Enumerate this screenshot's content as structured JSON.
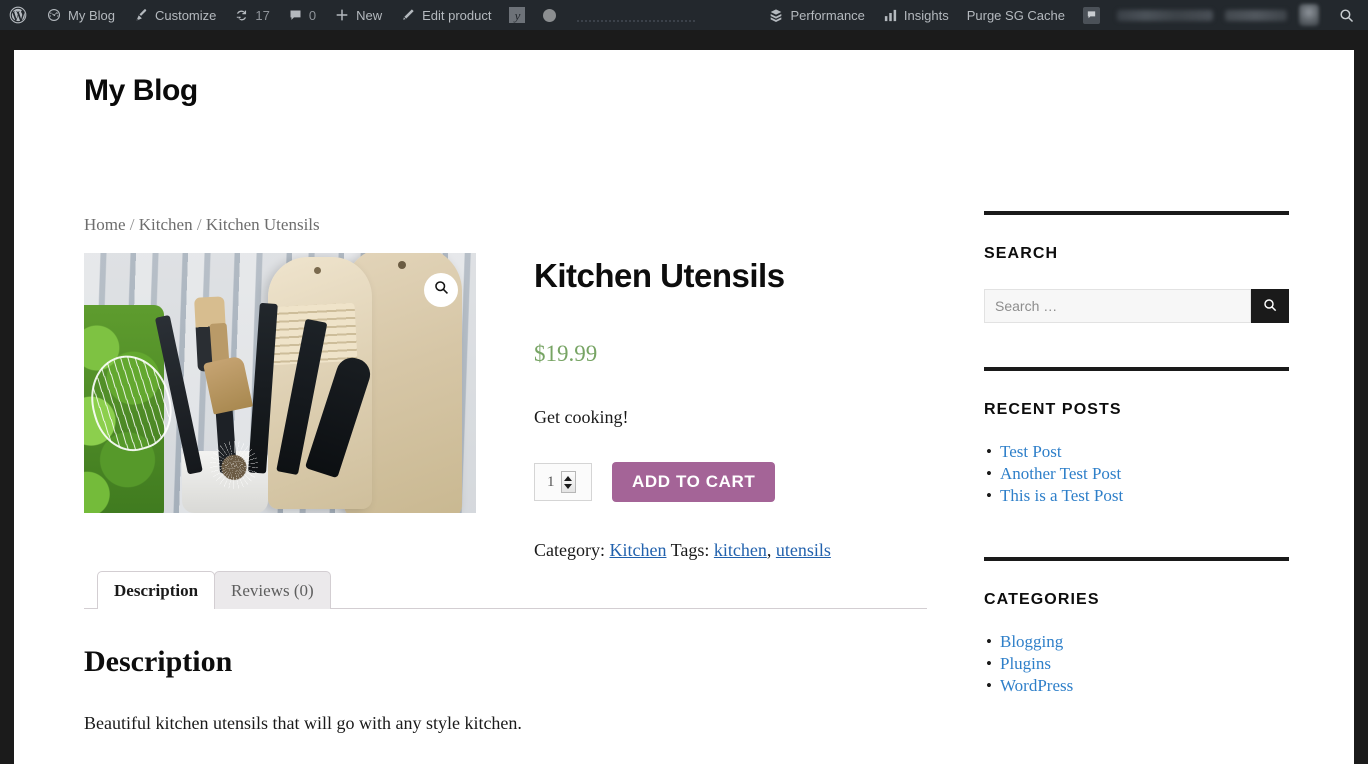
{
  "admin_bar": {
    "wp_logo_icon": "wordpress-logo-icon",
    "items": [
      {
        "label": "My Blog",
        "icon": "dashboard-gauge-icon"
      },
      {
        "label": "Customize",
        "icon": "paintbrush-icon"
      },
      {
        "label": "17",
        "icon": "updates-arrows-icon"
      },
      {
        "label": "0",
        "icon": "comment-bubble-icon"
      },
      {
        "label": "New",
        "icon": "plus-icon"
      },
      {
        "label": "Edit product",
        "icon": "pencil-icon"
      },
      {
        "label": "",
        "icon": "yoast-seo-icon"
      },
      {
        "label": "",
        "icon": "grey-dot-icon"
      }
    ],
    "right_items": [
      {
        "label": "Performance",
        "icon": "performance-icon"
      },
      {
        "label": "Insights",
        "icon": "bar-chart-icon"
      },
      {
        "label": "Purge SG Cache",
        "icon": ""
      }
    ],
    "notification_icon": "flag-icon",
    "search_icon": "search-icon",
    "user_name_redacted": "",
    "colors": {
      "bar_bg": "#23282d",
      "bar_text": "#b4b9be"
    }
  },
  "site": {
    "title": "My Blog",
    "page_frame_bg": "#1b1b1b"
  },
  "breadcrumb": {
    "items": [
      "Home",
      "Kitchen",
      "Kitchen Utensils"
    ],
    "separator": "/"
  },
  "product": {
    "title": "Kitchen Utensils",
    "price": "$19.99",
    "price_color": "#77a464",
    "short_description": "Get cooking!",
    "image_alt": "kitchen utensils in a white crock with wooden cutting boards and basil plant",
    "zoom_icon": "magnifier-icon",
    "quantity": "1",
    "add_to_cart_label": "ADD TO CART",
    "add_to_cart_color": "#a46497",
    "meta": {
      "category_label": "Category:",
      "category": "Kitchen",
      "tags_label": "Tags:",
      "tags": [
        "kitchen",
        "utensils"
      ],
      "tags_separator": ", "
    }
  },
  "tabs": [
    {
      "label": "Description",
      "active": true
    },
    {
      "label": "Reviews (0)",
      "active": false
    }
  ],
  "description_panel": {
    "heading": "Description",
    "body": "Beautiful kitchen utensils that will go with any style kitchen."
  },
  "sidebar": {
    "widgets": [
      {
        "title": "SEARCH",
        "type": "search",
        "search_placeholder": "Search …",
        "search_value": "",
        "search_icon": "search-icon"
      },
      {
        "title": "RECENT POSTS",
        "type": "list",
        "items": [
          "Test Post",
          "Another Test Post",
          "This is a Test Post"
        ]
      },
      {
        "title": "CATEGORIES",
        "type": "list",
        "items": [
          "Blogging",
          "Plugins",
          "WordPress"
        ]
      }
    ],
    "link_color": "#2e7fc9"
  }
}
